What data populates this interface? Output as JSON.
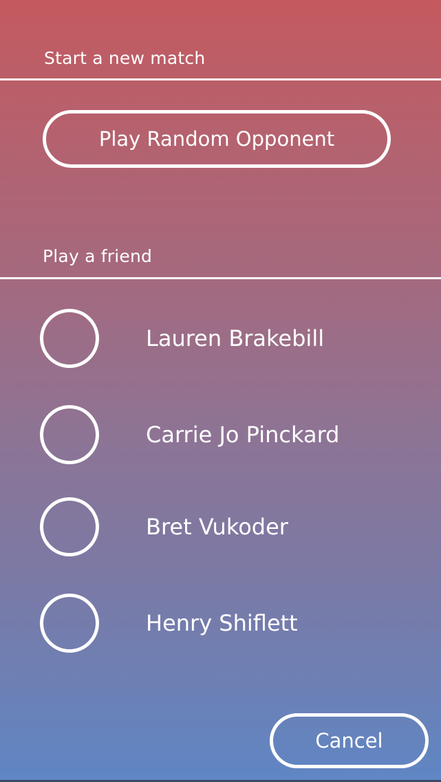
{
  "new_match": {
    "header": "Start a new match",
    "random_button_label": "Play Random Opponent"
  },
  "friends": {
    "header": "Play a friend",
    "items": [
      {
        "name": "Lauren Brakebill",
        "selected": false
      },
      {
        "name": "Carrie Jo Pinckard",
        "selected": false
      },
      {
        "name": "Bret Vukoder",
        "selected": false
      },
      {
        "name": "Henry Shiflett",
        "selected": false
      }
    ]
  },
  "footer": {
    "cancel_label": "Cancel"
  },
  "colors": {
    "gradient_top": "#c45a5f",
    "gradient_bottom": "#5f86c4",
    "foreground": "#ffffff"
  }
}
